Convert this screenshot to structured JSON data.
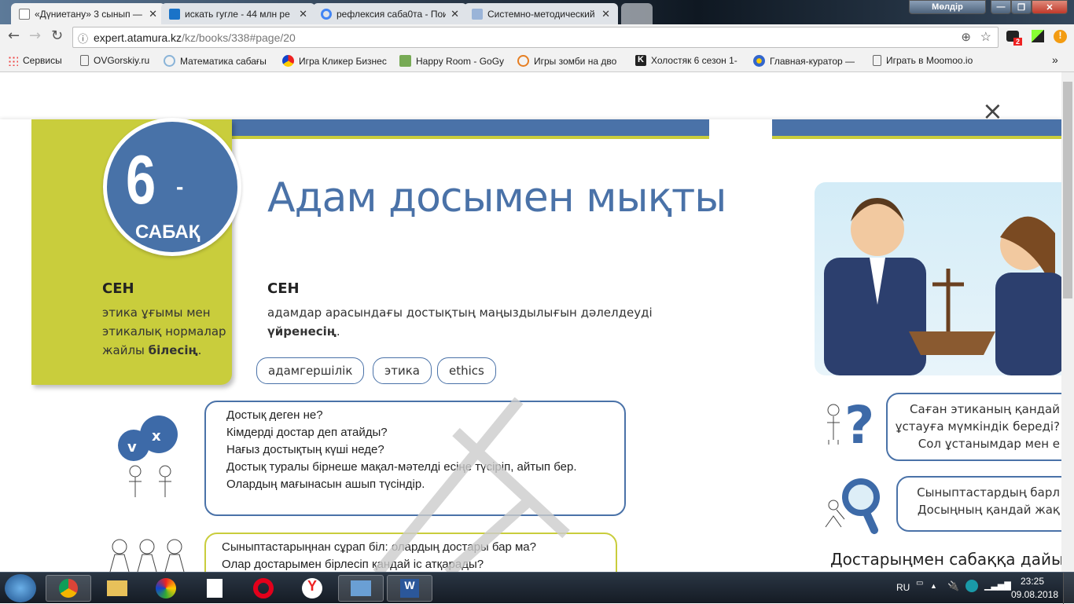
{
  "browser": {
    "tabs": [
      {
        "title": "«Дүниетану» 3 сынып —",
        "active": true
      },
      {
        "title": "искать гугле - 44 млн ре",
        "active": false
      },
      {
        "title": "рефлексия саба0та - Пои",
        "active": false
      },
      {
        "title": "Системно-методический",
        "active": false
      }
    ],
    "profile": "Мөлдір",
    "url_host": "expert.atamura.kz",
    "url_path": "/kz/books/338#page/20",
    "ext_badge": "2",
    "bookmarks": [
      "Сервисы",
      "OVGorskiy.ru",
      "Математика сабағы",
      "Игра Кликер Бизнес",
      "Happy Room - GoGy",
      "Игры зомби на дво",
      "Холостяк 6 сезон 1-",
      "Главная-куратор —",
      "Играть в Moomoo.io"
    ],
    "more": "»"
  },
  "viewer": {
    "close": "×"
  },
  "lesson": {
    "number": "6",
    "dash": "-",
    "label": "САБАҚ",
    "title": "Адам досымен мықты",
    "left_heading": "СЕН",
    "left_text": "этика ұғымы мен этикалық нормалар жайлы ",
    "left_bold": "білесің",
    "dot": ".",
    "main_heading": "СЕН",
    "main_text": "адамдар арасындағы достықтың маңыздылығын дәлелдеуді",
    "main_bold": "үйренесің",
    "keywords": [
      "адамгершілік",
      "этика",
      "ethics"
    ],
    "box1": [
      "Достық деген не?",
      "Кімдерді достар деп атайды?",
      "Нағыз достықтың күші неде?",
      "Достық туралы бірнеше мақал-мәтелді есіңе түсіріп, айтып бер.",
      "Олардың мағынасын ашып түсіндір."
    ],
    "box2": [
      "Сыныптастарыңнан сұрап біл: олардың достары бар ма?",
      "Олар достарымен бірлесіп қандай іс атқарады?"
    ],
    "right_box1": [
      "Саған этиканың қандай",
      "ұстауға мүмкіндік береді?",
      "Сол ұстанымдар мен е"
    ],
    "right_box2": [
      "Сыныптастардың барл",
      "Досыңның қандай жақ"
    ],
    "right_bottom": "Достарыңмен сабаққа дайынд"
  },
  "taskbar": {
    "lang": "RU",
    "time": "23:25",
    "date": "09.08.2018"
  },
  "colors": {
    "accent_blue": "#4a72a8",
    "accent_green": "#c9cd3c"
  }
}
